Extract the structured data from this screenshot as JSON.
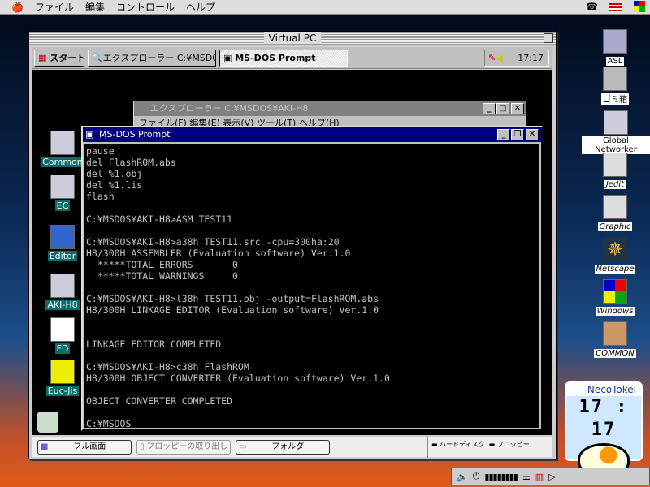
{
  "menubar": {
    "items": [
      "ファイル",
      "編集",
      "コントロール",
      "ヘルプ"
    ],
    "icons": [
      "apple-icon",
      "phone-icon",
      "us-flag-icon",
      "app-switcher-icon"
    ]
  },
  "vpc": {
    "title": "Virtual PC",
    "taskbar": {
      "start": "スタート",
      "items": [
        "エクスプローラー C:¥MSDOS¥...",
        "MS-DOS Prompt"
      ],
      "clock": "17:17"
    },
    "explorer": {
      "title": "エクスプローラー C:¥MSDOS¥AKI-H8",
      "menu": "ファイル(F)  編集(E)  表示(V)  ツール(T)  ヘルプ(H)"
    },
    "dos": {
      "title": "MS-DOS Prompt",
      "lines": [
        "pause",
        "del FlashROM.abs",
        "del %1.obj",
        "del %1.lis",
        "flash",
        "",
        "C:¥MSDOS¥AKI-H8>ASM TEST11",
        "",
        "C:¥MSDOS¥AKI-H8>a38h TEST11.src -cpu=300ha:20",
        "H8/300H ASSEMBLER (Evaluation software) Ver.1.0",
        "  *****TOTAL ERRORS       0",
        "  *****TOTAL WARNINGS     0",
        "",
        "C:¥MSDOS¥AKI-H8>l38h TEST11.obj -output=FlashROM.abs",
        "H8/300H LINKAGE EDITOR (Evaluation software) Ver.1.0",
        "",
        "",
        "LINKAGE EDITOR COMPLETED",
        "",
        "C:¥MSDOS¥AKI-H8>c38h FlashROM",
        "H8/300H OBJECT CONVERTER (Evaluation software) Ver.1.0",
        "",
        "OBJECT CONVERTER COMPLETED",
        "",
        "C:¥MSDOS"
      ]
    },
    "win_icons": [
      "Common",
      "EC",
      "Editor",
      "AKI-H8",
      "FD",
      "Euc-Jis"
    ],
    "bottom": {
      "fullscreen": "フル画面",
      "eject": "フロッピーの取り出し",
      "folder": "フォルダ",
      "hdd": "ハードディスク",
      "floppy": "フロッピー"
    }
  },
  "mac_icons": [
    "ASL",
    "ゴミ箱",
    "Global Networker",
    "Jedit",
    "Graphic",
    "Netscape",
    "Windows",
    "COMMON"
  ],
  "neco": {
    "title": "NecoTokei",
    "time": "17 : 17"
  }
}
